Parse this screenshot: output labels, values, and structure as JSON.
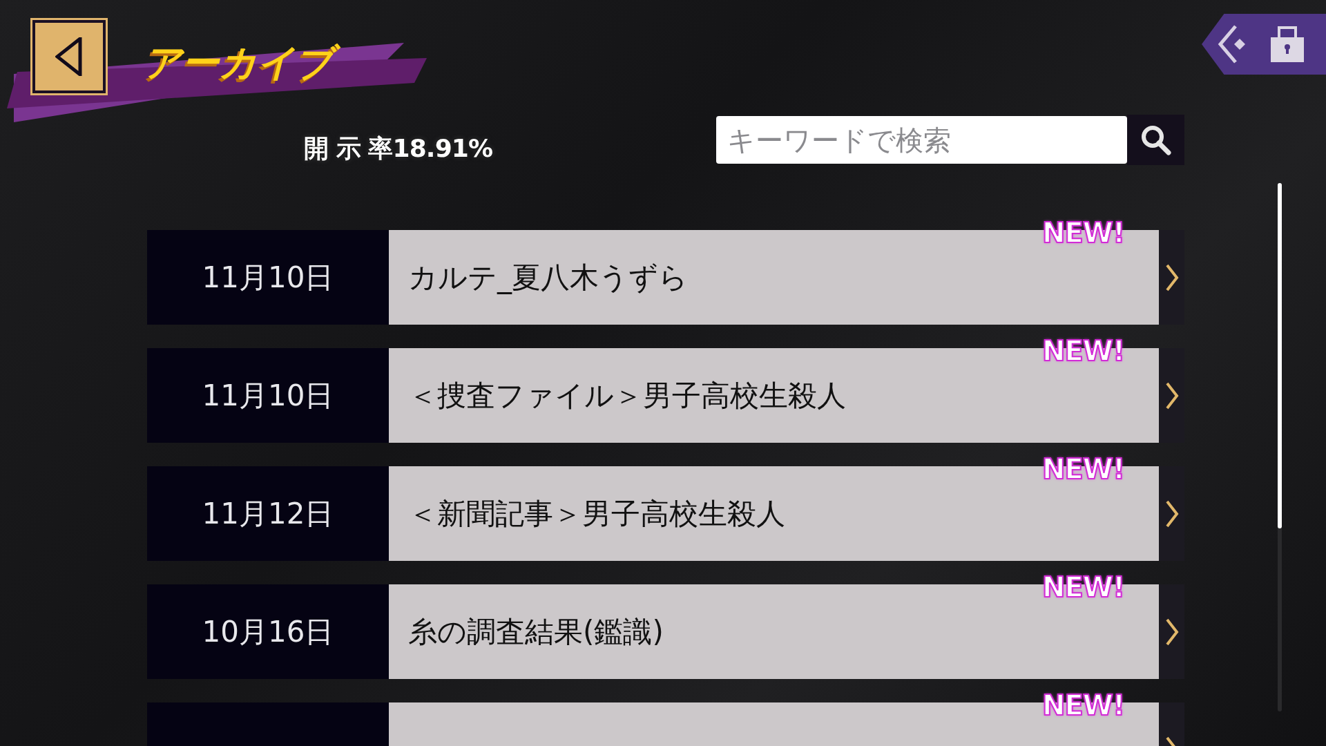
{
  "header": {
    "title": "アーカイブ",
    "disclosure_rate": "開 示 率18.91%"
  },
  "search": {
    "placeholder": "キーワードで検索"
  },
  "rows": [
    {
      "date": "11月10日",
      "title": "カルテ_夏八木うずら",
      "new": true,
      "badge": "NEW!"
    },
    {
      "date": "11月10日",
      "title": "＜捜査ファイル＞男子高校生殺人",
      "new": true,
      "badge": "NEW!"
    },
    {
      "date": "11月12日",
      "title": "＜新聞記事＞男子高校生殺人",
      "new": true,
      "badge": "NEW!"
    },
    {
      "date": "10月16日",
      "title": "糸の調査結果(鑑識)",
      "new": true,
      "badge": "NEW!"
    },
    {
      "new": true,
      "badge": "NEW!"
    }
  ]
}
